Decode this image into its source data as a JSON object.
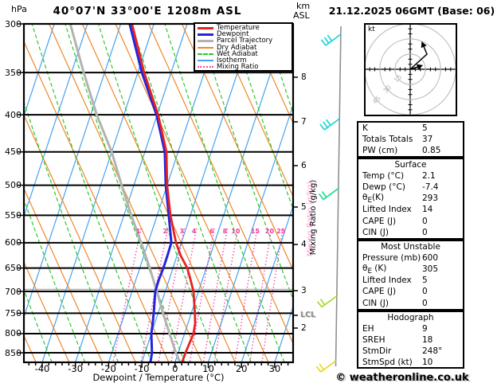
{
  "header": {
    "pressure_unit": "hPa",
    "title": "40°07'N 33°00'E 1208m ASL",
    "km_label": "km",
    "asl_label": "ASL",
    "datetime": "21.12.2025 06GMT (Base: 06)"
  },
  "colors": {
    "temperature": "#e62222",
    "dewpoint": "#2424dc",
    "parcel": "#b2b2b2",
    "dry_adiabat": "#f0882a",
    "wet_adiabat": "#2cc82c",
    "isotherm": "#46a2f0",
    "mixing_ratio": "#f846a6",
    "grid": "#000000",
    "height_line": "#aaaaaa",
    "barb_staff": "#909090"
  },
  "legend": {
    "items": [
      {
        "label": "Temperature",
        "key": "temperature",
        "weight": 3,
        "dash": "solid"
      },
      {
        "label": "Dewpoint",
        "key": "dewpoint",
        "weight": 3,
        "dash": "solid"
      },
      {
        "label": "Parcel Trajectory",
        "key": "parcel",
        "weight": 3,
        "dash": "solid"
      },
      {
        "label": "Dry Adiabat",
        "key": "dry_adiabat",
        "weight": 2,
        "dash": "solid"
      },
      {
        "label": "Wet Adiabat",
        "key": "wet_adiabat",
        "weight": 2,
        "dash": "dashed"
      },
      {
        "label": "Isotherm",
        "key": "isotherm",
        "weight": 2,
        "dash": "solid"
      },
      {
        "label": "Mixing Ratio",
        "key": "mixing_ratio",
        "weight": 2,
        "dash": "dotted"
      }
    ]
  },
  "axes": {
    "pressure_ticks": [
      300,
      350,
      400,
      450,
      500,
      550,
      600,
      650,
      700,
      750,
      800,
      850
    ],
    "temp_ticks": [
      -40,
      -30,
      -20,
      -10,
      0,
      10,
      20,
      30
    ],
    "x_label": "Dewpoint / Temperature (°C)",
    "km_ticks": [
      8,
      7,
      6,
      5,
      4,
      3,
      2
    ],
    "lcl_label": "LCL",
    "mixing_axis_label": "Mixing Ratio (g/kg)"
  },
  "hodograph": {
    "unit": "kt",
    "rings_kt": [
      "15",
      "30",
      "45"
    ],
    "traces_kt": [
      [
        [
          0,
          0
        ],
        [
          11,
          3.5
        ]
      ],
      [
        [
          0,
          0
        ],
        [
          16.5,
          15
        ],
        [
          12,
          26
        ]
      ]
    ]
  },
  "indices": {
    "boxes": [
      {
        "title": "",
        "rows": [
          {
            "l": "K",
            "v": "5"
          },
          {
            "l": "Totals Totals",
            "v": "37"
          },
          {
            "l": "PW (cm)",
            "v": "0.85"
          }
        ]
      },
      {
        "title": "Surface",
        "rows": [
          {
            "l": "Temp (°C)",
            "v": "2.1"
          },
          {
            "l": "Dewp (°C)",
            "v": "-7.4"
          },
          {
            "l": "θ",
            "sub": "E",
            "r": "(K)",
            "v": "293"
          },
          {
            "l": "Lifted Index",
            "v": "14"
          },
          {
            "l": "CAPE (J)",
            "v": "0"
          },
          {
            "l": "CIN (J)",
            "v": "0"
          }
        ]
      },
      {
        "title": "Most Unstable",
        "rows": [
          {
            "l": "Pressure (mb)",
            "v": "600"
          },
          {
            "l": "θ",
            "sub": "E",
            "r": " (K)",
            "v": "305"
          },
          {
            "l": "Lifted Index",
            "v": "5"
          },
          {
            "l": "CAPE (J)",
            "v": "0"
          },
          {
            "l": "CIN (J)",
            "v": "0"
          }
        ]
      },
      {
        "title": "Hodograph",
        "rows": [
          {
            "l": "EH",
            "v": "9"
          },
          {
            "l": "SREH",
            "v": "18"
          },
          {
            "l": "StmDir",
            "v": "248°"
          },
          {
            "l": "StmSpd (kt)",
            "v": "10"
          }
        ]
      }
    ]
  },
  "footer": {
    "credit": "© weatheronline.co.uk"
  },
  "chart_data": {
    "type": "skewt-log-p sounding",
    "title": "40°07'N 33°00'E 1208m ASL",
    "datetime": "21.12.2025 06GMT (Base: 06)",
    "pressure_axis_hPa": [
      300,
      350,
      400,
      450,
      500,
      550,
      600,
      650,
      700,
      750,
      800,
      850
    ],
    "temp_axis_C": [
      -40,
      -30,
      -20,
      -10,
      0,
      10,
      20,
      30
    ],
    "height_axis_km": [
      2,
      3,
      4,
      5,
      6,
      7,
      8
    ],
    "mixing_ratio_lines_gkg": [
      1,
      2,
      3,
      4,
      6,
      8,
      10,
      15,
      20,
      25
    ],
    "lcl_pressure_hPa": 752,
    "sounding_levels": [
      {
        "p": 300,
        "t": -46.6,
        "td": -47.3
      },
      {
        "p": 350,
        "t": -38.1,
        "td": -38.8
      },
      {
        "p": 400,
        "t": -29.7,
        "td": -30.2
      },
      {
        "p": 450,
        "t": -23.5,
        "td": -24.0
      },
      {
        "p": 500,
        "t": -20.0,
        "td": -20.4
      },
      {
        "p": 550,
        "t": -16.0,
        "td": -16.5
      },
      {
        "p": 600,
        "t": -11.6,
        "td": -13.0
      },
      {
        "p": 625,
        "t": -8.9,
        "td": -12.9
      },
      {
        "p": 650,
        "t": -5.7,
        "td": -12.9
      },
      {
        "p": 675,
        "t": -3.5,
        "td": -13.1
      },
      {
        "p": 700,
        "t": -1.5,
        "td": -13.0
      },
      {
        "p": 750,
        "t": 1.1,
        "td": -11.3
      },
      {
        "p": 775,
        "t": 2.2,
        "td": -10.6
      },
      {
        "p": 800,
        "t": 2.7,
        "td": -10.0
      },
      {
        "p": 850,
        "t": 2.2,
        "td": -7.9
      },
      {
        "p": 876,
        "t": 2.1,
        "td": -7.4
      }
    ],
    "parcel_trajectory": [
      {
        "p": 300,
        "t": -65.2
      },
      {
        "p": 350,
        "t": -56.3
      },
      {
        "p": 400,
        "t": -48.2
      },
      {
        "p": 450,
        "t": -40.0
      },
      {
        "p": 500,
        "t": -33.7
      },
      {
        "p": 550,
        "t": -27.8
      },
      {
        "p": 600,
        "t": -22.1
      },
      {
        "p": 650,
        "t": -17.0
      },
      {
        "p": 700,
        "t": -12.5
      },
      {
        "p": 750,
        "t": -8.5
      },
      {
        "p": 800,
        "t": -4.5
      },
      {
        "p": 850,
        "t": -0.7
      },
      {
        "p": 876,
        "t": 1.5
      }
    ],
    "wind_barbs": [
      {
        "p": 310,
        "ticks": 3,
        "color": "#22d4d4"
      },
      {
        "p": 405,
        "ticks": 3,
        "color": "#22d4d4"
      },
      {
        "p": 505,
        "ticks": 2,
        "color": "#1ede8e"
      },
      {
        "p": 710,
        "ticks": 2,
        "color": "#aadc22"
      },
      {
        "p": 872,
        "ticks": 2,
        "color": "#e8d826"
      }
    ],
    "hodograph_rings_kt": [
      15,
      30,
      45
    ],
    "indices": {
      "K": 5,
      "TotalsTotals": 37,
      "PW_cm": 0.85,
      "surface": {
        "temp_C": 2.1,
        "dewp_C": -7.4,
        "thetaE_K": 293,
        "lifted_index": 14,
        "CAPE_J": 0,
        "CIN_J": 0
      },
      "most_unstable": {
        "pressure_mb": 600,
        "thetaE_K": 305,
        "lifted_index": 5,
        "CAPE_J": 0,
        "CIN_J": 0
      },
      "hodograph": {
        "EH": 9,
        "SREH": 18,
        "StmDir_deg": 248,
        "StmSpd_kt": 10
      }
    }
  }
}
